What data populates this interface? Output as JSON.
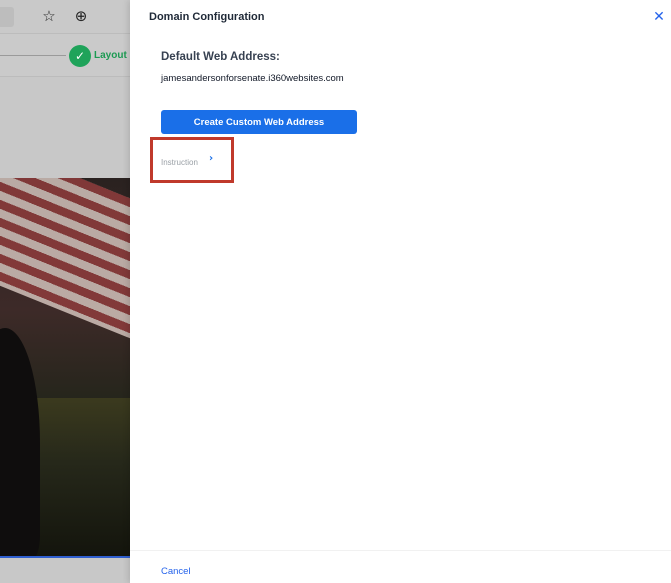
{
  "background": {
    "toolbar": {
      "star_icon": "star-icon",
      "add_icon": "plus-circle-icon",
      "star_glyph": "☆",
      "add_glyph": "⊕"
    },
    "progress": {
      "step_label": "Layout",
      "step_state": "complete",
      "check_glyph": "✓",
      "accent": "#1fa35a"
    }
  },
  "drawer": {
    "title": "Domain Configuration",
    "close_glyph": "✕",
    "default_address_heading": "Default Web Address:",
    "default_address_value": "jamesandersonforsenate.i360websites.com",
    "create_button_label": "Create Custom Web Address",
    "instruction_label": "Instruction",
    "instruction_chevron": "›",
    "cancel_label": "Cancel",
    "accent": "#1a6fe8",
    "highlight_color": "#c0392b"
  }
}
